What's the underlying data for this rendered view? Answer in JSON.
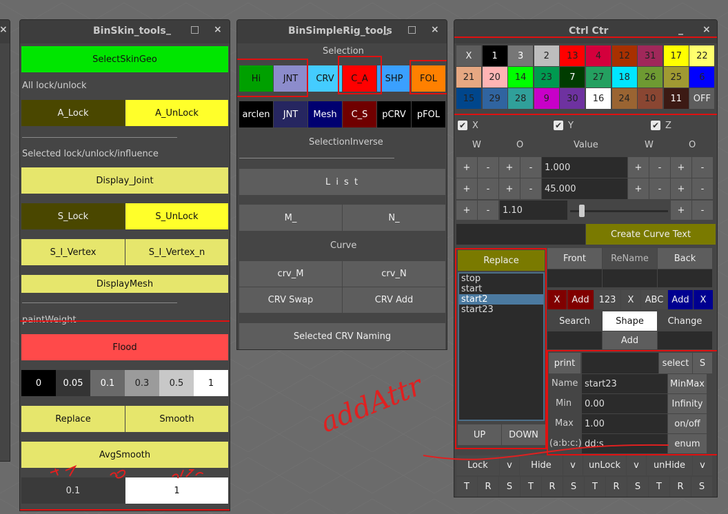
{
  "left_edge_close": "×",
  "binskin": {
    "title": "BinSkin_tools",
    "min": "_",
    "max": "□",
    "close": "×",
    "select_skin_geo": "SelectSkinGeo",
    "all_lock_label": "All lock/unlock",
    "a_lock": "A_Lock",
    "a_unlock": "A_UnLock",
    "selected_label": "Selected lock/unlock/influence",
    "display_joint": "Display_Joint",
    "s_lock": "S_Lock",
    "s_unlock": "S_UnLock",
    "s_i_vertex": "S_I_Vertex",
    "s_i_vertex_n": "S_I_Vertex_n",
    "display_mesh": "DisplayMesh",
    "paint_label": "paintWeight",
    "flood": "Flood",
    "weights": [
      "0",
      "0.05",
      "0.1",
      "0.3",
      "0.5",
      "1"
    ],
    "replace": "Replace",
    "smooth": "Smooth",
    "avg_smooth": "AvgSmooth",
    "val_a": "0.1",
    "val_b": "1"
  },
  "rig": {
    "title": "BinSimpleRig_tools",
    "min": "_",
    "max": "□",
    "close": "×",
    "selection_label": "Selection",
    "row1": [
      "Hi",
      "JNT",
      "CRV",
      "C_A",
      "SHP",
      "FOL"
    ],
    "row2": [
      "arclen",
      "JNT",
      "Mesh",
      "C_S",
      "pCRV",
      "pFOL"
    ],
    "selection_inverse": "SelectionInverse",
    "list": "L i s t",
    "m": "M_",
    "n": "N_",
    "curve_label": "Curve",
    "crv_m": "crv_M",
    "crv_n": "crv_N",
    "crv_swap": "CRV Swap",
    "crv_add": "CRV Add",
    "selected_naming": "Selected CRV Naming"
  },
  "ctrl": {
    "title": "Ctrl Ctr",
    "min": "_",
    "close": "×",
    "colors": [
      {
        "l": "X",
        "bg": "#5d5d5d",
        "fg": "#eee"
      },
      {
        "l": "1",
        "bg": "#000000",
        "fg": "#fff"
      },
      {
        "l": "3",
        "bg": "#777777",
        "fg": "#fff"
      },
      {
        "l": "2",
        "bg": "#bdbdbd",
        "fg": "#222"
      },
      {
        "l": "13",
        "bg": "#ff0000",
        "fg": "#222"
      },
      {
        "l": "4",
        "bg": "#d4003c",
        "fg": "#222"
      },
      {
        "l": "12",
        "bg": "#a83000",
        "fg": "#222"
      },
      {
        "l": "31",
        "bg": "#a0285a",
        "fg": "#222"
      },
      {
        "l": "17",
        "bg": "#ffff00",
        "fg": "#222"
      },
      {
        "l": "22",
        "bg": "#ffff6e",
        "fg": "#222"
      },
      {
        "l": "21",
        "bg": "#e6a882",
        "fg": "#222"
      },
      {
        "l": "20",
        "bg": "#ffb4b4",
        "fg": "#222"
      },
      {
        "l": "14",
        "bg": "#00ff00",
        "fg": "#222"
      },
      {
        "l": "23",
        "bg": "#009a50",
        "fg": "#222"
      },
      {
        "l": "7",
        "bg": "#003c00",
        "fg": "#fff"
      },
      {
        "l": "27",
        "bg": "#24a060",
        "fg": "#222"
      },
      {
        "l": "18",
        "bg": "#00e6ff",
        "fg": "#222"
      },
      {
        "l": "26",
        "bg": "#6e9a32",
        "fg": "#222"
      },
      {
        "l": "25",
        "bg": "#a09a32",
        "fg": "#222"
      },
      {
        "l": "6",
        "bg": "#0000ff",
        "fg": "#222"
      },
      {
        "l": "15",
        "bg": "#00468c",
        "fg": "#222"
      },
      {
        "l": "29",
        "bg": "#3064a0",
        "fg": "#222"
      },
      {
        "l": "28",
        "bg": "#30a09a",
        "fg": "#222"
      },
      {
        "l": "9",
        "bg": "#c800c8",
        "fg": "#222"
      },
      {
        "l": "30",
        "bg": "#6e32a0",
        "fg": "#222"
      },
      {
        "l": "16",
        "bg": "#ffffff",
        "fg": "#222"
      },
      {
        "l": "24",
        "bg": "#9a6432",
        "fg": "#222"
      },
      {
        "l": "10",
        "bg": "#8a4632",
        "fg": "#222"
      },
      {
        "l": "11",
        "bg": "#3c1a14",
        "fg": "#fff"
      },
      {
        "l": "OFF",
        "bg": "#5d5d5d",
        "fg": "#eee"
      }
    ],
    "chk_x": "X",
    "chk_y": "Y",
    "chk_z": "Z",
    "check": "✔",
    "hdr": [
      "W",
      "O",
      "Value",
      "W",
      "O"
    ],
    "plus": "+",
    "minus": "-",
    "val1": "1.000",
    "val2": "45.000",
    "val3": "1.10",
    "create_curve_text": "Create Curve Text",
    "replace": "Replace",
    "list_items": [
      "stop",
      "start",
      "start2",
      "start23"
    ],
    "up": "UP",
    "down": "DOWN",
    "front": "Front",
    "rename": "ReName",
    "back": "Back",
    "x": "X",
    "add": "Add",
    "n123": "123",
    "abc": "ABC",
    "search": "Search",
    "shape": "Shape",
    "change": "Change",
    "print": "print",
    "select": "select",
    "s": "S",
    "name_label": "Name",
    "name_val": "start23",
    "minmax": "MinMax",
    "min_label": "Min",
    "min_val": "0.00",
    "infinity": "Infinity",
    "max_label": "Max",
    "max_val": "1.00",
    "onoff": "on/off",
    "enum_label": "(a:b:c:)",
    "enum_val": "dd:s",
    "enum": "enum",
    "lock": "Lock",
    "v": "v",
    "hide": "Hide",
    "unlock": "unLock",
    "unhide": "unHide",
    "trs": [
      "T",
      "R",
      "S",
      "T",
      "R",
      "S",
      "T",
      "R",
      "S",
      "T",
      "R",
      "S"
    ]
  },
  "handwriting": "addAttr"
}
